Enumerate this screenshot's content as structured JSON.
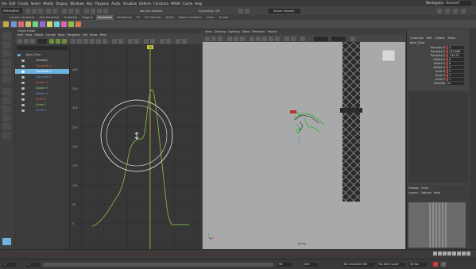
{
  "menubar": {
    "items": [
      "File",
      "Edit",
      "Create",
      "Select",
      "Modify",
      "Display",
      "Windows",
      "Key",
      "Playback",
      "Audio",
      "Visualize",
      "Deform",
      "Constrain",
      "MASH",
      "Cache",
      "Help"
    ],
    "workspace_label": "Workspace:",
    "workspace_value": "General*"
  },
  "statusline": {
    "mode": "Animation",
    "live_surface": "No Live Surface",
    "symmetry": "Symmetry: Off",
    "user": "Steven Roselle"
  },
  "shelf_tabs": [
    "Curves / Surfaces",
    "Poly Modeling",
    "Sculpting",
    "Rigging",
    "Animation",
    "Rendering",
    "FX",
    "FX Caching",
    "MASH",
    "Motion Graphics",
    "XGen",
    "Arnold"
  ],
  "shelf_active": "Animation",
  "graph_editor": {
    "title": "Graph Editor",
    "menu": [
      "Edit",
      "View",
      "Select",
      "Curves",
      "Keys",
      "Tangents",
      "List",
      "Show",
      "Help"
    ],
    "outliner": {
      "items": [
        {
          "label": "Joint_Char",
          "color": "#cfcfcf"
        },
        {
          "label": "Visibility",
          "color": "#cfcfcf"
        },
        {
          "label": "Translate X",
          "color": "#d45a5a"
        },
        {
          "label": "Translate Y",
          "color": "#8fd46a",
          "selected": true
        },
        {
          "label": "Translate Z",
          "color": "#6a8fd4"
        },
        {
          "label": "Rotate X",
          "color": "#d45a5a"
        },
        {
          "label": "Rotate Y",
          "color": "#8fd46a"
        },
        {
          "label": "Rotate Z",
          "color": "#6a8fd4"
        },
        {
          "label": "Scale X",
          "color": "#d45a5a"
        },
        {
          "label": "Scale Y",
          "color": "#8fd46a"
        },
        {
          "label": "Scale Z",
          "color": "#6a8fd4"
        }
      ]
    },
    "y_ticks": [
      "400",
      "350",
      "300",
      "250",
      "200",
      "150",
      "100",
      "50",
      "0"
    ],
    "current_frame_label": "30"
  },
  "viewport": {
    "menu": [
      "View",
      "Shading",
      "Lighting",
      "Show",
      "Renderer",
      "Panels"
    ],
    "camera_label": "persp"
  },
  "channel_box": {
    "menu": [
      "Channels",
      "Edit",
      "Object",
      "Show"
    ],
    "object": "Joint_Char",
    "attributes": [
      {
        "label": "Translate X",
        "value": "0",
        "keyed": true
      },
      {
        "label": "Translate Y",
        "value": "152.868",
        "keyed": true
      },
      {
        "label": "Translate Z",
        "value": "-134.51",
        "keyed": true
      },
      {
        "label": "Rotate X",
        "value": "0",
        "keyed": true
      },
      {
        "label": "Rotate Y",
        "value": "0",
        "keyed": true
      },
      {
        "label": "Rotate Z",
        "value": "0",
        "keyed": true
      },
      {
        "label": "Scale X",
        "value": "1",
        "keyed": true
      },
      {
        "label": "Scale Y",
        "value": "1",
        "keyed": true
      },
      {
        "label": "Scale Z",
        "value": "1",
        "keyed": true
      },
      {
        "label": "Visibility",
        "value": "on",
        "keyed": false
      }
    ],
    "layer_tabs": [
      "Display",
      "Anim"
    ],
    "layer_menu": [
      "Layers",
      "Options",
      "Help"
    ]
  },
  "range": {
    "start": "1",
    "current": "1",
    "end": "96",
    "anim_end": "400",
    "char_set": "No Character Set",
    "anim_layer": "No Anim Layer",
    "fps": "30 fps"
  },
  "colors": {
    "accent": "#6fb2e0",
    "curve": "#7fb04a",
    "keyed": "#d23a3a",
    "current_time": "#cccc3a"
  }
}
